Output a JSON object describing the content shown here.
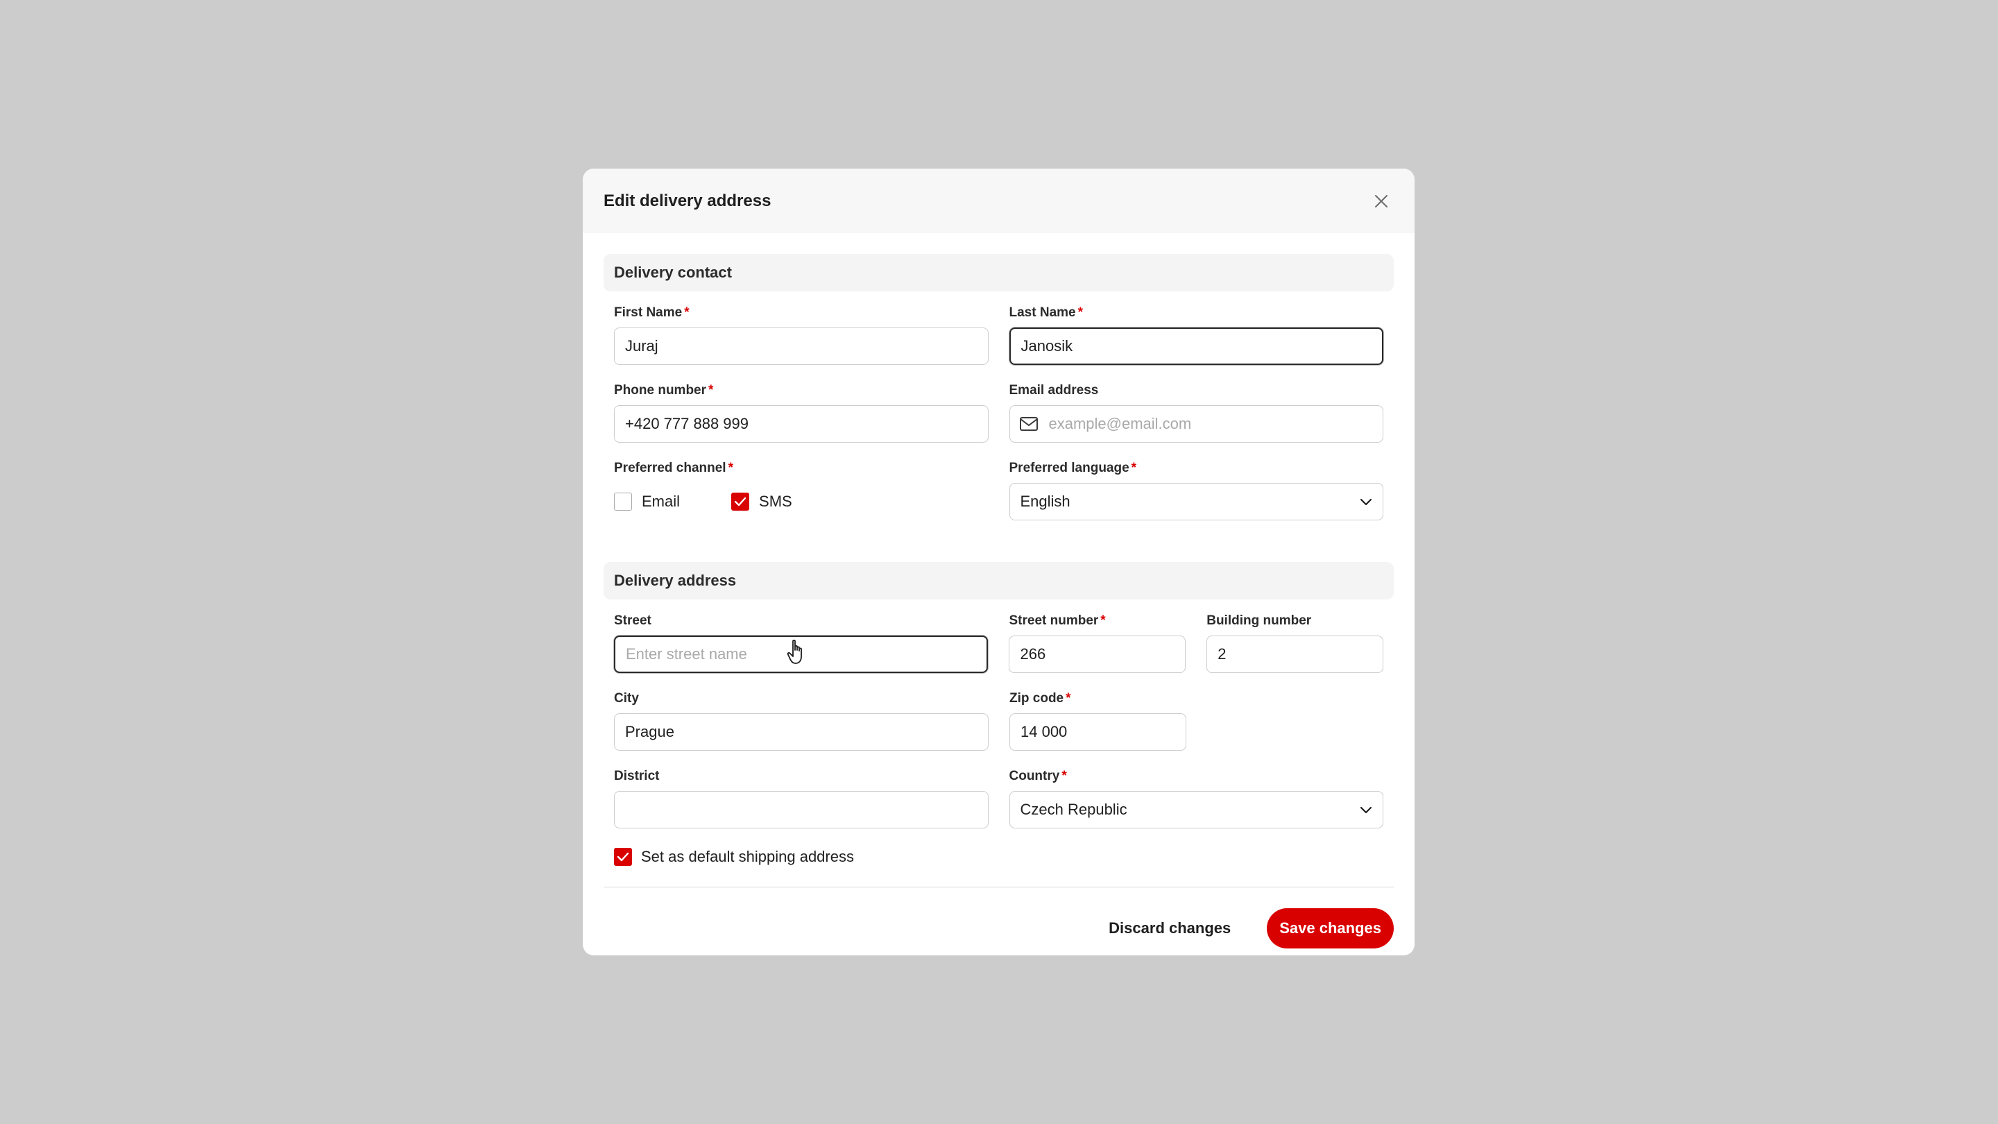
{
  "modal": {
    "title": "Edit delivery address",
    "close_icon": "close-icon"
  },
  "contact": {
    "section_title": "Delivery contact",
    "first_name": {
      "label": "First Name",
      "value": "Juraj",
      "required": "*"
    },
    "last_name": {
      "label": "Last Name",
      "value": "Janosik",
      "required": "*"
    },
    "phone": {
      "label": "Phone number",
      "value": "+420 777 888 999",
      "required": "*"
    },
    "email": {
      "label": "Email address",
      "value": "",
      "placeholder": "example@email.com",
      "icon": "mail-icon"
    },
    "channel": {
      "label": "Preferred channel",
      "required": "*",
      "options": [
        {
          "label": "Email",
          "checked": false
        },
        {
          "label": "SMS",
          "checked": true
        }
      ]
    },
    "language": {
      "label": "Preferred language",
      "value": "English",
      "required": "*"
    }
  },
  "address": {
    "section_title": "Delivery address",
    "street": {
      "label": "Street",
      "value": "",
      "placeholder": "Enter street name"
    },
    "street_number": {
      "label": "Street number",
      "value": "266",
      "required": "*"
    },
    "building_number": {
      "label": "Building number",
      "value": "2"
    },
    "city": {
      "label": "City",
      "value": "Prague"
    },
    "zip": {
      "label": "Zip code",
      "value": "14 000",
      "required": "*"
    },
    "district": {
      "label": "District",
      "value": ""
    },
    "country": {
      "label": "Country",
      "value": "Czech Republic",
      "required": "*"
    },
    "default_shipping": {
      "label": "Set as default shipping address",
      "checked": true
    }
  },
  "footer": {
    "discard_label": "Discard changes",
    "save_label": "Save changes"
  },
  "colors": {
    "accent": "#d90000",
    "backdrop": "#cccccc",
    "section_bg": "#f4f4f4"
  }
}
